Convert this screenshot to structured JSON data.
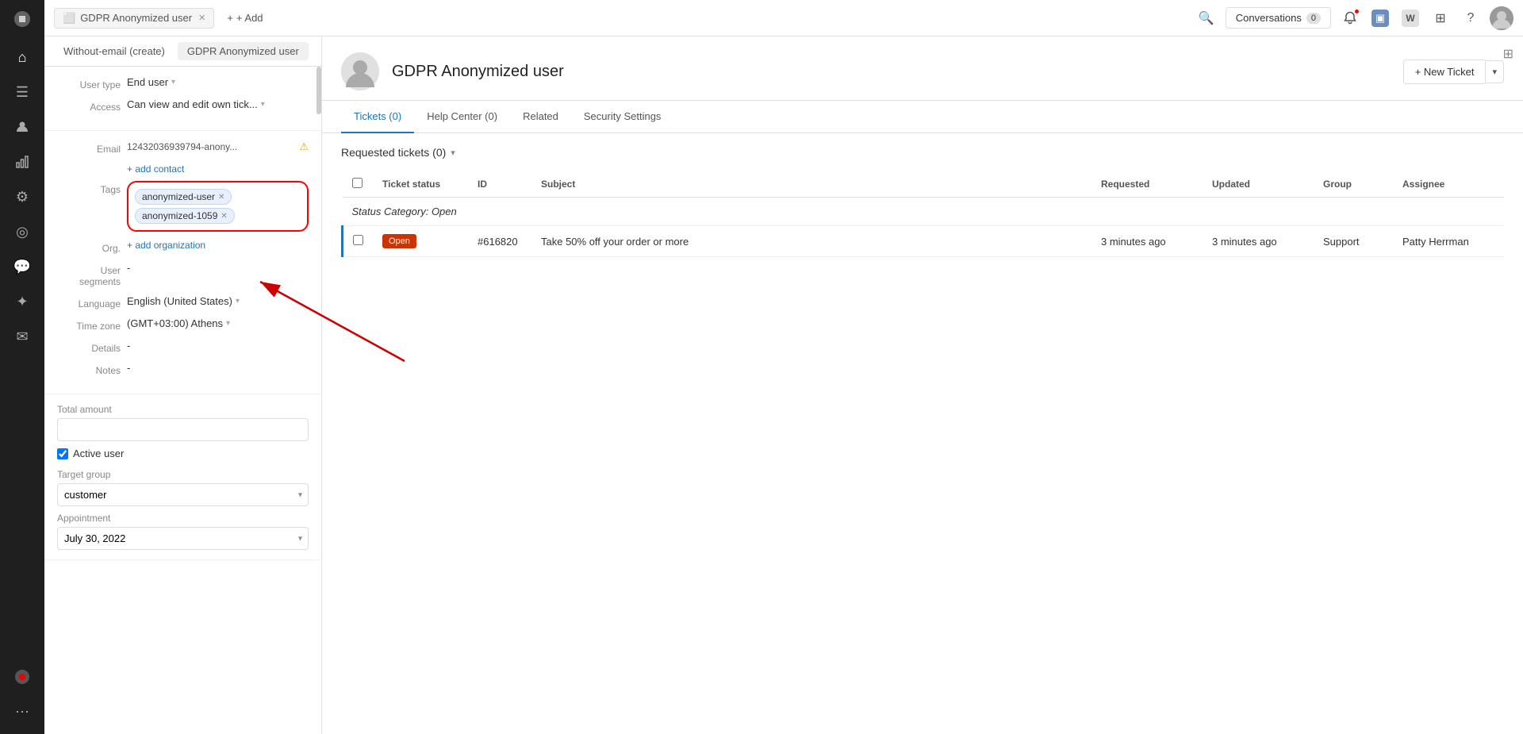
{
  "app": {
    "title": "Zendesk"
  },
  "topbar": {
    "tab_label": "GDPR Anonymized user",
    "add_label": "+ Add",
    "conversations_label": "Conversations",
    "conversations_count": "0"
  },
  "secondary_tabs": [
    {
      "label": "Without-email (create)",
      "active": false
    },
    {
      "label": "GDPR Anonymized user",
      "active": true
    }
  ],
  "left_panel": {
    "user_type_label": "User type",
    "user_type_value": "End user",
    "access_label": "Access",
    "access_value": "Can view and edit own tick...",
    "email_label": "Email",
    "email_value": "12432036939794-anony...",
    "add_contact_label": "+ add contact",
    "tags_label": "Tags",
    "tags": [
      {
        "name": "anonymized-user"
      },
      {
        "name": "anonymized-1059"
      }
    ],
    "org_label": "Org.",
    "add_org_label": "+ add organization",
    "user_segments_label": "User segments",
    "user_segments_value": "-",
    "language_label": "Language",
    "language_value": "English (United States)",
    "timezone_label": "Time zone",
    "timezone_value": "(GMT+03:00) Athens",
    "details_label": "Details",
    "details_value": "-",
    "notes_label": "Notes",
    "notes_value": "-",
    "total_amount_label": "Total amount",
    "active_user_label": "Active user",
    "target_group_label": "Target group",
    "target_group_value": "customer",
    "appointment_label": "Appointment",
    "appointment_value": "July 30, 2022"
  },
  "right_panel": {
    "user_name": "GDPR Anonymized user",
    "new_ticket_label": "+ New Ticket",
    "tabs": [
      {
        "label": "Tickets (0)",
        "active": true
      },
      {
        "label": "Help Center (0)",
        "active": false
      },
      {
        "label": "Related",
        "active": false
      },
      {
        "label": "Security Settings",
        "active": false
      }
    ],
    "requested_tickets_label": "Requested tickets (0)",
    "table": {
      "columns": [
        {
          "key": "checkbox",
          "label": ""
        },
        {
          "key": "status",
          "label": "Ticket status"
        },
        {
          "key": "id",
          "label": "ID"
        },
        {
          "key": "subject",
          "label": "Subject"
        },
        {
          "key": "requested",
          "label": "Requested"
        },
        {
          "key": "updated",
          "label": "Updated"
        },
        {
          "key": "group",
          "label": "Group"
        },
        {
          "key": "assignee",
          "label": "Assignee"
        }
      ],
      "status_category": "Status Category: Open",
      "rows": [
        {
          "status": "Open",
          "id": "#616820",
          "subject": "Take 50% off your order or more",
          "requested": "3 minutes ago",
          "updated": "3 minutes ago",
          "group": "Support",
          "assignee": "Patty Herrman"
        }
      ]
    }
  },
  "sidebar_nav": {
    "items": [
      {
        "icon": "⌂",
        "name": "home-icon"
      },
      {
        "icon": "☰",
        "name": "tickets-icon"
      },
      {
        "icon": "👤",
        "name": "users-icon"
      },
      {
        "icon": "📊",
        "name": "reports-icon"
      },
      {
        "icon": "⚙",
        "name": "settings-icon"
      },
      {
        "icon": "◎",
        "name": "apps-icon"
      },
      {
        "icon": "💬",
        "name": "chat-icon"
      },
      {
        "icon": "✦",
        "name": "spark-icon"
      },
      {
        "icon": "✉",
        "name": "email-icon"
      },
      {
        "icon": "🔴",
        "name": "status-icon"
      },
      {
        "icon": "⋯",
        "name": "more-icon"
      }
    ]
  }
}
